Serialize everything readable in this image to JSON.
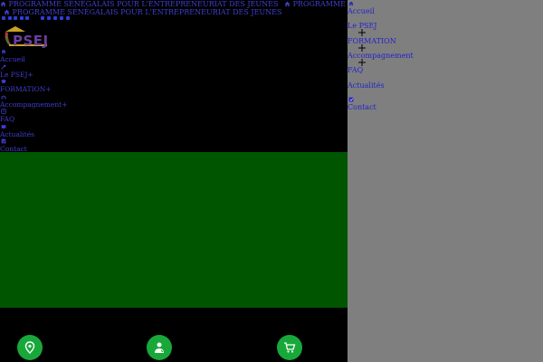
{
  "topbar": {
    "title_1": "PROGRAMME SÉNÉGALAIS POUR L'ENTREPRENEURIAT DES JEUNES",
    "title_2": "PROGRAMME SENEGALAIS",
    "title_3": "PROGRAMME SÉNÉGALAIS POUR L'ENTREPRENEURIAT DES JEUNES"
  },
  "brand": {
    "logo_text": "PSEJ"
  },
  "left_nav": {
    "items": [
      {
        "label": "Accueil",
        "icon": "home-icon"
      },
      {
        "label": "Le PSEJ+",
        "icon": "key-icon"
      },
      {
        "label": "FORMATION+",
        "icon": "graduation-cap-icon"
      },
      {
        "label": "Accompagnement+",
        "icon": "support-icon"
      },
      {
        "label": "FAQ",
        "icon": "question-icon"
      },
      {
        "label": "Actualités",
        "icon": "news-icon"
      },
      {
        "label": "Contact",
        "icon": "contact-icon"
      }
    ]
  },
  "bottom_actions": [
    {
      "icon": "location-pin-icon"
    },
    {
      "icon": "user-support-icon"
    },
    {
      "icon": "shopping-cart-icon"
    }
  ],
  "side_panel": {
    "items": [
      {
        "label": "Accueil"
      },
      {
        "label": "Le PSEJ"
      },
      {
        "label": "FORMATION"
      },
      {
        "label": "Accompagnement"
      },
      {
        "label": "FAQ"
      },
      {
        "label": "Actualités"
      },
      {
        "label": "Contact"
      }
    ]
  },
  "colors": {
    "page_bg": "#000000",
    "banner_green": "#005500",
    "action_green": "#18a83a",
    "panel_grey": "#7f7f7f",
    "link_blue": "#2222cc"
  }
}
